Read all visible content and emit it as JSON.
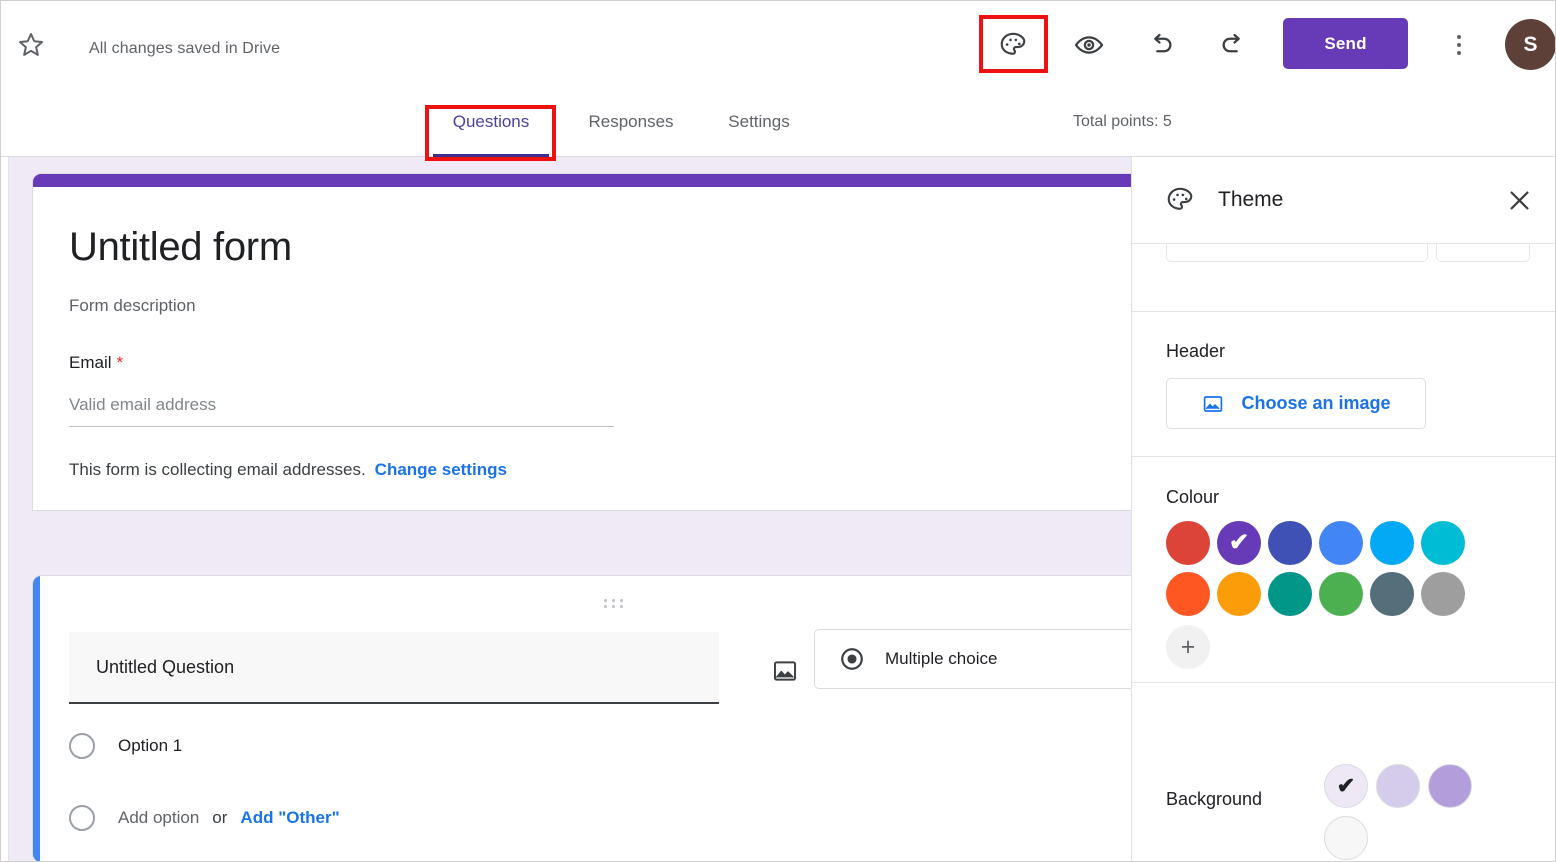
{
  "topbar": {
    "star_icon": "star-outline-icon",
    "saved_status": "All changes saved in Drive",
    "palette_icon": "palette-icon",
    "preview_icon": "eye-preview-icon",
    "undo_icon": "undo-icon",
    "redo_icon": "redo-icon",
    "send_label": "Send",
    "more_icon": "more-vert-icon",
    "avatar_initial": "S",
    "avatar_color": "#5d4037",
    "send_color": "#673ab7"
  },
  "tabs": {
    "items": [
      {
        "label": "Questions",
        "active": true
      },
      {
        "label": "Responses",
        "active": false
      },
      {
        "label": "Settings",
        "active": false
      }
    ],
    "total_points": "Total points: 5",
    "active_color": "#3b2f8f"
  },
  "annotations": {
    "color": "#ee1111",
    "boxes": [
      "palette-icon",
      "questions-tab"
    ]
  },
  "form": {
    "accent_color": "#673ab7",
    "title": "Untitled form",
    "description": "Form description",
    "email_label": "Email",
    "required_marker": "*",
    "email_placeholder": "Valid email address",
    "collecting_note": "This form is collecting email addresses.",
    "change_settings_link": "Change settings",
    "background_color": "#f0eaf7"
  },
  "question": {
    "accent_color": "#4285f4",
    "drag_handle_icon": "drag-handle-icon",
    "title": "Untitled Question",
    "image_icon": "insert-image-icon",
    "type_icon": "radio-button-icon",
    "type_label": "Multiple choice",
    "caret_icon": "chevron-down-icon",
    "options": [
      {
        "label": "Option 1",
        "muted": false
      }
    ],
    "add_option_label": "Add option",
    "or_label": "or",
    "add_other_label": "Add \"Other\""
  },
  "theme_panel": {
    "header_icon": "palette-icon",
    "header_title": "Theme",
    "close_icon": "close-icon",
    "header_section": {
      "title": "Header",
      "choose_image_icon": "image-icon",
      "choose_image_label": "Choose an image"
    },
    "colour_section": {
      "title": "Colour",
      "swatches": [
        {
          "name": "red",
          "hex": "#db4437",
          "selected": false
        },
        {
          "name": "purple",
          "hex": "#673ab7",
          "selected": true
        },
        {
          "name": "indigo",
          "hex": "#3f51b5",
          "selected": false
        },
        {
          "name": "blue",
          "hex": "#4285f4",
          "selected": false
        },
        {
          "name": "light-blue",
          "hex": "#03a9f4",
          "selected": false
        },
        {
          "name": "cyan",
          "hex": "#00bcd4",
          "selected": false
        },
        {
          "name": "deep-orange",
          "hex": "#ff5722",
          "selected": false
        },
        {
          "name": "orange",
          "hex": "#fb9c09",
          "selected": false
        },
        {
          "name": "teal",
          "hex": "#009688",
          "selected": false
        },
        {
          "name": "green",
          "hex": "#4caf50",
          "selected": false
        },
        {
          "name": "blue-grey",
          "hex": "#546e7a",
          "selected": false
        },
        {
          "name": "grey",
          "hex": "#9e9e9e",
          "selected": false
        }
      ],
      "add_custom_label": "+",
      "check_glyph": "✔"
    },
    "background_section": {
      "label": "Background",
      "swatches": [
        {
          "name": "lightest-lavender",
          "hex": "#ede7f6",
          "selected": true
        },
        {
          "name": "light-lavender",
          "hex": "#d5cbea",
          "selected": false
        },
        {
          "name": "medium-lavender",
          "hex": "#b39ddb",
          "selected": false
        },
        {
          "name": "white",
          "hex": "#f7f7f7",
          "selected": false
        }
      ],
      "check_glyph": "✔"
    }
  }
}
